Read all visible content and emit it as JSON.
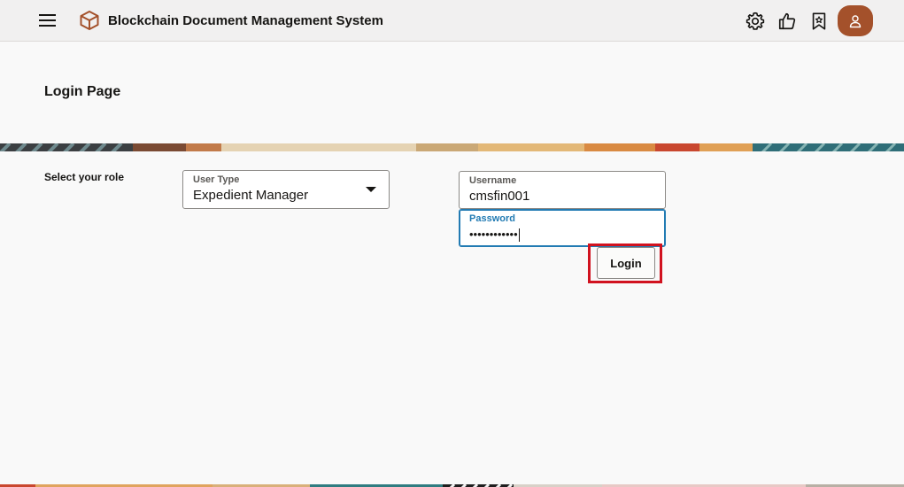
{
  "header": {
    "title": "Blockchain Document Management System"
  },
  "page": {
    "title": "Login Page"
  },
  "form": {
    "role_label": "Select your role",
    "user_type": {
      "label": "User Type",
      "value": "Expedient Manager"
    },
    "username": {
      "label": "Username",
      "value": "cmsfin001"
    },
    "password": {
      "label": "Password",
      "masked_value": "••••••••••••"
    },
    "login_label": "Login"
  },
  "colors": {
    "accent": "#227bb3",
    "avatar": "#a4512b",
    "highlight": "#d1121f",
    "logo": "#a4512b"
  },
  "icons": [
    "hamburger-menu-icon",
    "app-logo-cube-icon",
    "settings-gear-icon",
    "thumbs-up-icon",
    "bookmark-icon",
    "user-icon",
    "dropdown-arrow-icon"
  ]
}
